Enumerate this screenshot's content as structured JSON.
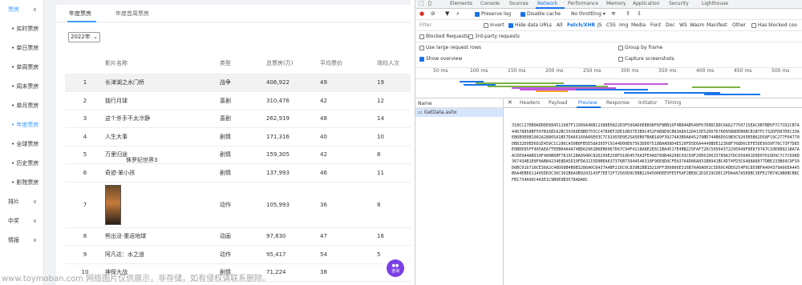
{
  "sidebar": {
    "top": {
      "label": "票房"
    },
    "items": [
      {
        "label": "• 实时票房"
      },
      {
        "label": "• 单日票房"
      },
      {
        "label": "• 单周票房"
      },
      {
        "label": "• 周末票房"
      },
      {
        "label": "• 单月票房"
      },
      {
        "label": "• 年度票房"
      },
      {
        "label": "• 全球票房"
      },
      {
        "label": "• 历史票房"
      },
      {
        "label": "• 影院票房"
      }
    ],
    "groups": [
      {
        "label": "排片"
      },
      {
        "label": "中奖"
      },
      {
        "label": "情报"
      }
    ]
  },
  "tabs": [
    {
      "label": "年度票房"
    },
    {
      "label": "年度首周票房"
    }
  ],
  "year_select": "2022年",
  "table": {
    "headers": [
      "",
      "影片名称",
      "类型",
      "总票房(万)",
      "平均票价",
      "场均人次"
    ],
    "rows": [
      {
        "rank": "1",
        "title": "长津湖之水门桥",
        "genre": "战争",
        "gross": "406,922",
        "price": "49",
        "audience": "19"
      },
      {
        "rank": "2",
        "title": "独行月球",
        "genre": "喜剧",
        "gross": "310,476",
        "price": "42",
        "audience": "12"
      },
      {
        "rank": "3",
        "title": "这个杀手不太冷静",
        "genre": "喜剧",
        "gross": "262,919",
        "price": "48",
        "audience": "14"
      },
      {
        "rank": "4",
        "title": "人生大事",
        "genre": "剧情",
        "gross": "171,316",
        "price": "40",
        "audience": "10"
      },
      {
        "rank": "5",
        "title": "万里归途",
        "genre": "剧情",
        "gross": "159,305",
        "price": "42",
        "audience": "8"
      },
      {
        "rank": "6",
        "title": "奇迹·笨小孩",
        "genre": "剧情",
        "gross": "137,993",
        "price": "46",
        "audience": "11"
      },
      {
        "rank": "7",
        "title": "侏罗纪世界3",
        "genre": "动作",
        "gross": "105,993",
        "price": "36",
        "audience": "8"
      },
      {
        "rank": "8",
        "title": "熊出没·重返地球",
        "genre": "动画",
        "gross": "97,830",
        "price": "47",
        "audience": "16"
      },
      {
        "rank": "9",
        "title": "阿凡达：水之道",
        "genre": "动作",
        "gross": "95,417",
        "price": "54",
        "audience": "5"
      },
      {
        "rank": "10",
        "title": "神探大战",
        "genre": "剧情",
        "gross": "71,224",
        "price": "38",
        "audience": ""
      }
    ]
  },
  "chat_label": "咨询",
  "watermark": "www.toymoban.com 网络图片仅供展示，非存储，如有侵权请联系删除。",
  "devtools": {
    "tabs": [
      "Elements",
      "Console",
      "Sources",
      "Network",
      "Performance",
      "Memory",
      "Application",
      "Security",
      "Lighthouse"
    ],
    "toolbar": {
      "preserve_log": "Preserve log",
      "disable_cache": "Disable cache",
      "throttle": "No throttling"
    },
    "filter": {
      "placeholder": "Filter",
      "invert": "Invert",
      "hide_data_urls": "Hide data URLs",
      "types": [
        "All",
        "Fetch/XHR",
        "JS",
        "CSS",
        "Img",
        "Media",
        "Font",
        "Doc",
        "WS",
        "Wasm",
        "Manifest",
        "Other"
      ],
      "blocked_cookies": "Has blocked coo",
      "blocked_requests": "Blocked Requests",
      "third_party": "3rd-party requests"
    },
    "options": {
      "large_rows": "Use large request rows",
      "group_by_frame": "Group by frame",
      "show_overview": "Show overview",
      "capture_screenshots": "Capture screenshots"
    },
    "timeline_ticks": [
      "50 ms",
      "100 ms",
      "150 ms",
      "200 ms",
      "250 ms",
      "300 ms",
      "350 ms",
      "400 ms",
      "450 ms",
      "500 ms"
    ],
    "req_header": "Name",
    "request": "GetData.ashx",
    "detail_tabs": [
      "Headers",
      "Payload",
      "Preview",
      "Response",
      "Initiator",
      "Timing"
    ],
    "preview_text": "318CC27DB0ADDDE884511987F11969A46B11388E0822D3F599AD0EB896F6F8BB16F4B84AB548F67D0DC8DC6A627750715EAC0B7BB5F7C7CD2CB7A44678858BF597B16B162BC59368E8BD755CC4780EF2DE16B37E3B9C452FAB8D9CB83A8912D415E52D07676D95B8DEB0BCB1B7FC732DFD87DEC33AEB6B9E0B1902A28865A1B57DA66160A66E03C7C91955E0E25A5EB07BAB1A9F39274A3B9A845279BD744B6D019B3C9205B5B62D58F19C277F04770DB832D9ED6D1E459C1C286CA50B0FB5E58A395FC9144D00E67563DD07518BAAD8D4E520FD5E6A4449BDE12368F768D6CEFE5DE9939F76C73F7D85E0BDE85FF405AEA7TEEB04A4A74BD02061B6EB0067D67C94F4118A8E2E6C1BA4517E4BB225FAF72DC50564372295949F8E8797A7C10E6B9218A7AAC6E9A4AB910F489B6BF7819C2BA094DC82D299E258F910D4576A3FE0A8789B4A208C03C69F20E61D633789A37DC050A01D0D07016D9C7C7C698D36743AB1E8F0AB84234E8DA5D19FDA3215D0BEA637376B73944546318F96E8D0CFEA37A4D86A831B8941BC4D74FD3C6488A8077DBE233B69C9F39D0BC916710CE36A2C46D68B4B9B3286A0C8437A4BF216C0C839B2BB1D210FF3D0806E316B7AA0AD01C5D60C4DE0254F6C859BFA404379A66EA445B6A4EBE611405DD3C36C302B6A9B9203143F7EE72F72565D9CEBB2294500DEE5FE5F5AF2BE8C2D1E29CDEC2FDA4A7A5E8BC3EFE27B74CAB0BCB8CFB1734A90C4A3E1C9B6E9B3578A8A8C"
  }
}
